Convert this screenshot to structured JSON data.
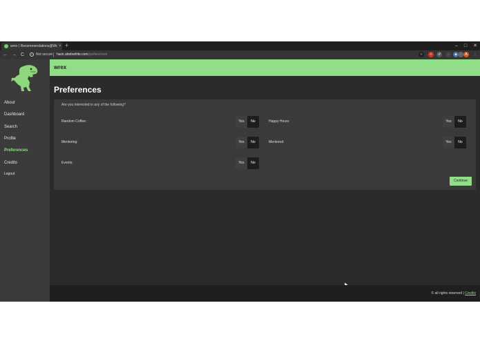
{
  "browser": {
    "tab_title": "wrex | Recommendations@Work",
    "tab_close": "×",
    "new_tab": "+",
    "window_controls": [
      "–",
      "□",
      "✕"
    ],
    "nav": [
      "←",
      "→",
      "C"
    ],
    "security_label": "Not secure",
    "url_host": "hack.abobwhite.com",
    "url_path": "/preferences",
    "extension_icons": [
      {
        "name": "star-icon",
        "glyph": "☆",
        "color": "#1e1e1e"
      },
      {
        "name": "red-extension-icon",
        "glyph": "•",
        "color": "#d9342b"
      },
      {
        "name": "history-extension-icon",
        "glyph": "↺",
        "color": "#555555"
      },
      {
        "name": "dark-extension-icon",
        "glyph": "·",
        "color": "#444444"
      },
      {
        "name": "shield-extension-icon",
        "glyph": "◈",
        "color": "#4a6fa5"
      },
      {
        "name": "grey-extension-icon",
        "glyph": "·",
        "color": "#666666"
      },
      {
        "name": "profile-avatar-icon",
        "glyph": "A",
        "color": "#d4582a"
      },
      {
        "name": "menu-icon",
        "glyph": "⋮",
        "color": "#353535"
      }
    ]
  },
  "sidebar": {
    "items": [
      {
        "label": "About",
        "active": false
      },
      {
        "label": "Dashboard",
        "active": false
      },
      {
        "label": "Search",
        "active": false
      },
      {
        "label": "Profile",
        "active": false
      },
      {
        "label": "Preferences",
        "active": true
      },
      {
        "label": "Credits",
        "active": false
      },
      {
        "label": "Logout",
        "active": false
      }
    ]
  },
  "header": {
    "brand": "wrex"
  },
  "main": {
    "title": "Preferences",
    "question": "Are you interested in any of the following?",
    "preferences": [
      {
        "label": "Random Coffee:",
        "yes": "Yes",
        "no": "No",
        "selected": "No"
      },
      {
        "label": "Happy Hours:",
        "yes": "Yes",
        "no": "No",
        "selected": "No"
      },
      {
        "label": "Mentoring:",
        "yes": "Yes",
        "no": "No",
        "selected": "No"
      },
      {
        "label": "Mentored:",
        "yes": "Yes",
        "no": "No",
        "selected": "No"
      },
      {
        "label": "Events:",
        "yes": "Yes",
        "no": "No",
        "selected": "No"
      }
    ],
    "continue_label": "Continue"
  },
  "footer": {
    "text": "© all rights reserved | ",
    "link": "Credits"
  },
  "colors": {
    "accent": "#90de87",
    "background": "#2b2b2b",
    "sidebar": "#3b3b3b",
    "card": "#3a3a3a"
  }
}
